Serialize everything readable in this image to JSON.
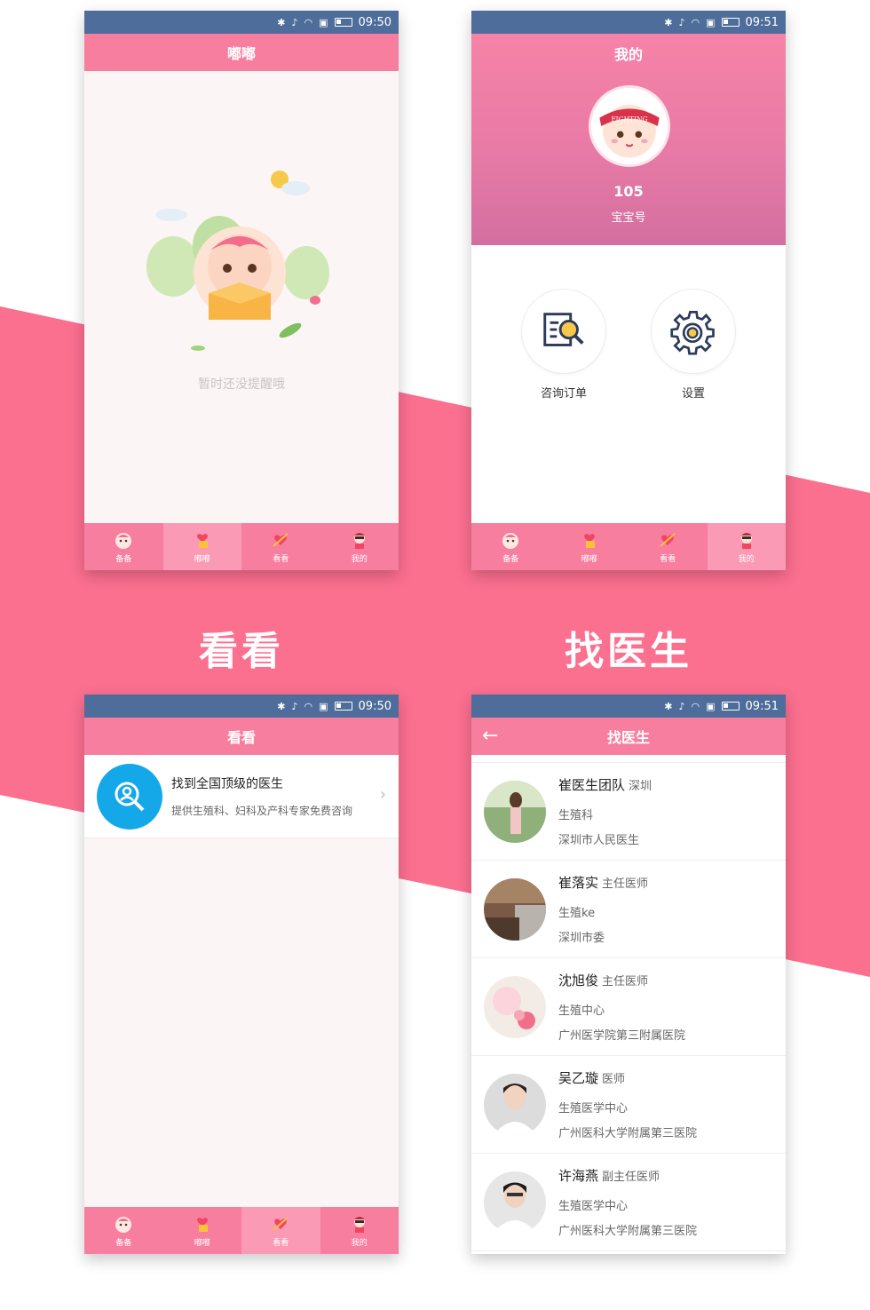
{
  "colors": {
    "pink": "#f87ea0",
    "statusbar": "#4e6d9a",
    "band": "#fb6f8f"
  },
  "status_times": [
    "09:50",
    "09:51",
    "09:50",
    "09:51"
  ],
  "tabs": [
    "备备",
    "嘟嘟",
    "看看",
    "我的"
  ],
  "dudu": {
    "title": "嘟嘟",
    "empty_text": "暂时还没提醒哦"
  },
  "mine": {
    "title": "我的",
    "avatar_badge": "FIGHTING",
    "number": "105",
    "number_label": "宝宝号",
    "actions": [
      {
        "label": "咨询订单",
        "icon": "document-search-icon"
      },
      {
        "label": "设置",
        "icon": "gear-icon"
      }
    ]
  },
  "kan": {
    "title": "看看",
    "promo_title": "找到全国顶级的医生",
    "promo_sub": "提供生殖科、妇科及产科专家免费咨询"
  },
  "captions": {
    "kan": "看看",
    "doctor": "找医生"
  },
  "doctor": {
    "title": "找医生",
    "list": [
      {
        "name": "崔医生团队",
        "title": "深圳",
        "dept": "生殖科",
        "hospital": "深圳市人民医生"
      },
      {
        "name": "崔落实",
        "title": "主任医师",
        "dept": "生殖ke",
        "hospital": "深圳市委"
      },
      {
        "name": "沈旭俊",
        "title": "主任医师",
        "dept": "生殖中心",
        "hospital": "广州医学院第三附属医院"
      },
      {
        "name": "吴乙璇",
        "title": "医师",
        "dept": "生殖医学中心",
        "hospital": "广州医科大学附属第三医院"
      },
      {
        "name": "许海燕",
        "title": "副主任医师",
        "dept": "生殖医学中心",
        "hospital": "广州医科大学附属第三医院"
      }
    ]
  }
}
